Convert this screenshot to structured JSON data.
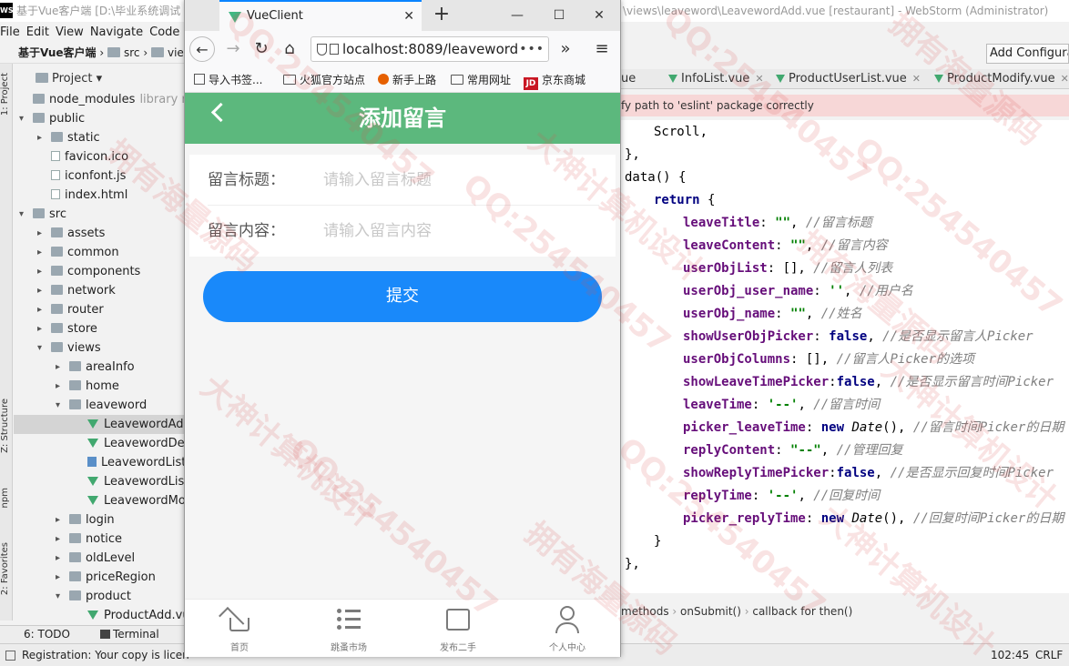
{
  "ide": {
    "title_left": "基于Vue客户端 [D:\\毕业系统调试",
    "title_right": "\\views\\leaveword\\LeavewordAdd.vue [restaurant] - WebStorm (Administrator)",
    "menu": [
      "File",
      "Edit",
      "View",
      "Navigate",
      "Code"
    ],
    "breadcrumb_project": "基于Vue客户端",
    "breadcrumb_src": "src",
    "breadcrumb_views": "vie",
    "project_label": "Project",
    "add_config": "Add Configurat",
    "side_tabs": {
      "project": "1: Project",
      "structure": "Z: Structure",
      "npm": "npm",
      "favorites": "2: Favorites"
    },
    "tree": [
      {
        "label": "node_modules",
        "extra": "library root",
        "type": "dir",
        "indent": 0,
        "arrow": ""
      },
      {
        "label": "public",
        "extra": "",
        "type": "dir",
        "indent": 0,
        "arrow": "▾"
      },
      {
        "label": "static",
        "extra": "",
        "type": "dir",
        "indent": 1,
        "arrow": "▸"
      },
      {
        "label": "favicon.ico",
        "extra": "",
        "type": "file",
        "indent": 1,
        "arrow": ""
      },
      {
        "label": "iconfont.js",
        "extra": "",
        "type": "file",
        "indent": 1,
        "arrow": ""
      },
      {
        "label": "index.html",
        "extra": "",
        "type": "file",
        "indent": 1,
        "arrow": ""
      },
      {
        "label": "src",
        "extra": "",
        "type": "dir",
        "indent": 0,
        "arrow": "▾"
      },
      {
        "label": "assets",
        "extra": "",
        "type": "dir",
        "indent": 1,
        "arrow": "▸"
      },
      {
        "label": "common",
        "extra": "",
        "type": "dir",
        "indent": 1,
        "arrow": "▸"
      },
      {
        "label": "components",
        "extra": "",
        "type": "dir",
        "indent": 1,
        "arrow": "▸"
      },
      {
        "label": "network",
        "extra": "",
        "type": "dir",
        "indent": 1,
        "arrow": "▸"
      },
      {
        "label": "router",
        "extra": "",
        "type": "dir",
        "indent": 1,
        "arrow": "▸"
      },
      {
        "label": "store",
        "extra": "",
        "type": "dir",
        "indent": 1,
        "arrow": "▸"
      },
      {
        "label": "views",
        "extra": "",
        "type": "dir",
        "indent": 1,
        "arrow": "▾"
      },
      {
        "label": "areaInfo",
        "extra": "",
        "type": "dir",
        "indent": 2,
        "arrow": "▸"
      },
      {
        "label": "home",
        "extra": "",
        "type": "dir",
        "indent": 2,
        "arrow": "▸"
      },
      {
        "label": "leaveword",
        "extra": "",
        "type": "dir",
        "indent": 2,
        "arrow": "▾"
      },
      {
        "label": "LeavewordAdd.vue",
        "extra": "",
        "type": "vue",
        "indent": 3,
        "arrow": "",
        "selected": true
      },
      {
        "label": "LeavewordDetail.vue",
        "extra": "",
        "type": "vue",
        "indent": 3,
        "arrow": ""
      },
      {
        "label": "LeavewordList.css",
        "extra": "",
        "type": "css",
        "indent": 3,
        "arrow": ""
      },
      {
        "label": "LeavewordList.vue",
        "extra": "",
        "type": "vue",
        "indent": 3,
        "arrow": ""
      },
      {
        "label": "LeavewordModify.vue",
        "extra": "",
        "type": "vue",
        "indent": 3,
        "arrow": ""
      },
      {
        "label": "login",
        "extra": "",
        "type": "dir",
        "indent": 2,
        "arrow": "▸"
      },
      {
        "label": "notice",
        "extra": "",
        "type": "dir",
        "indent": 2,
        "arrow": "▸"
      },
      {
        "label": "oldLevel",
        "extra": "",
        "type": "dir",
        "indent": 2,
        "arrow": "▸"
      },
      {
        "label": "priceRegion",
        "extra": "",
        "type": "dir",
        "indent": 2,
        "arrow": "▸"
      },
      {
        "label": "product",
        "extra": "",
        "type": "dir",
        "indent": 2,
        "arrow": "▾"
      },
      {
        "label": "ProductAdd.vue",
        "extra": "",
        "type": "vue",
        "indent": 3,
        "arrow": ""
      }
    ],
    "editor_tabs": [
      {
        "label": "ue",
        "closable": false
      },
      {
        "label": "InfoList.vue",
        "closable": true
      },
      {
        "label": "ProductUserList.vue",
        "closable": true
      },
      {
        "label": "ProductModify.vue",
        "closable": true
      }
    ],
    "warning": "fy path to 'eslint' package correctly",
    "code_lines": [
      {
        "indent": 1,
        "parts": [
          {
            "t": "Scroll,",
            "c": ""
          }
        ]
      },
      {
        "indent": 0,
        "parts": [
          {
            "t": "},",
            "c": ""
          }
        ]
      },
      {
        "indent": 0,
        "parts": [
          {
            "t": "data() {",
            "c": ""
          }
        ]
      },
      {
        "indent": 1,
        "parts": [
          {
            "t": "return",
            "c": "k"
          },
          {
            "t": " {",
            "c": ""
          }
        ]
      },
      {
        "indent": 2,
        "parts": [
          {
            "t": "leaveTitle",
            "c": "p"
          },
          {
            "t": ": ",
            "c": ""
          },
          {
            "t": "\"\"",
            "c": "s"
          },
          {
            "t": ", ",
            "c": ""
          },
          {
            "t": "//留言标题",
            "c": "c"
          }
        ]
      },
      {
        "indent": 2,
        "parts": [
          {
            "t": "leaveContent",
            "c": "p"
          },
          {
            "t": ": ",
            "c": ""
          },
          {
            "t": "\"\"",
            "c": "s"
          },
          {
            "t": ", ",
            "c": ""
          },
          {
            "t": "//留言内容",
            "c": "c"
          }
        ]
      },
      {
        "indent": 2,
        "parts": [
          {
            "t": "userObjList",
            "c": "p"
          },
          {
            "t": ": [], ",
            "c": ""
          },
          {
            "t": "//留言人列表",
            "c": "c"
          }
        ]
      },
      {
        "indent": 2,
        "parts": [
          {
            "t": "userObj_user_name",
            "c": "p"
          },
          {
            "t": ": ",
            "c": ""
          },
          {
            "t": "''",
            "c": "s"
          },
          {
            "t": ", ",
            "c": ""
          },
          {
            "t": "//用户名",
            "c": "c"
          }
        ]
      },
      {
        "indent": 2,
        "parts": [
          {
            "t": "userObj_name",
            "c": "p"
          },
          {
            "t": ": ",
            "c": ""
          },
          {
            "t": "\"\"",
            "c": "s"
          },
          {
            "t": ", ",
            "c": ""
          },
          {
            "t": "//姓名",
            "c": "c"
          }
        ]
      },
      {
        "indent": 2,
        "parts": [
          {
            "t": "showUserObjPicker",
            "c": "p"
          },
          {
            "t": ": ",
            "c": ""
          },
          {
            "t": "false",
            "c": "k"
          },
          {
            "t": ", ",
            "c": ""
          },
          {
            "t": "//是否显示留言人Picker",
            "c": "c"
          }
        ]
      },
      {
        "indent": 2,
        "parts": [
          {
            "t": "userObjColumns",
            "c": "p"
          },
          {
            "t": ": [], ",
            "c": ""
          },
          {
            "t": "//留言人Picker的选项",
            "c": "c"
          }
        ]
      },
      {
        "indent": 2,
        "parts": [
          {
            "t": "showLeaveTimePicker",
            "c": "p"
          },
          {
            "t": ":",
            "c": ""
          },
          {
            "t": "false",
            "c": "k"
          },
          {
            "t": ", ",
            "c": ""
          },
          {
            "t": "//是否显示留言时间Picker",
            "c": "c"
          }
        ]
      },
      {
        "indent": 2,
        "parts": [
          {
            "t": "leaveTime",
            "c": "p"
          },
          {
            "t": ": ",
            "c": ""
          },
          {
            "t": "'--'",
            "c": "s"
          },
          {
            "t": ", ",
            "c": ""
          },
          {
            "t": "//留言时间",
            "c": "c"
          }
        ]
      },
      {
        "indent": 2,
        "parts": [
          {
            "t": "picker_leaveTime",
            "c": "p"
          },
          {
            "t": ": ",
            "c": ""
          },
          {
            "t": "new",
            "c": "k"
          },
          {
            "t": " ",
            "c": ""
          },
          {
            "t": "Date",
            "c": "t"
          },
          {
            "t": "(), ",
            "c": ""
          },
          {
            "t": "//留言时间Picker的日期",
            "c": "c"
          }
        ]
      },
      {
        "indent": 2,
        "parts": [
          {
            "t": "replyContent",
            "c": "p"
          },
          {
            "t": ": ",
            "c": ""
          },
          {
            "t": "\"--\"",
            "c": "s"
          },
          {
            "t": ", ",
            "c": ""
          },
          {
            "t": "//管理回复",
            "c": "c"
          }
        ]
      },
      {
        "indent": 2,
        "parts": [
          {
            "t": "showReplyTimePicker",
            "c": "p"
          },
          {
            "t": ":",
            "c": ""
          },
          {
            "t": "false",
            "c": "k"
          },
          {
            "t": ", ",
            "c": ""
          },
          {
            "t": "//是否显示回复时间Picker",
            "c": "c"
          }
        ]
      },
      {
        "indent": 2,
        "parts": [
          {
            "t": "replyTime",
            "c": "p"
          },
          {
            "t": ": ",
            "c": ""
          },
          {
            "t": "'--'",
            "c": "s"
          },
          {
            "t": ", ",
            "c": ""
          },
          {
            "t": "//回复时间",
            "c": "c"
          }
        ]
      },
      {
        "indent": 2,
        "parts": [
          {
            "t": "picker_replyTime",
            "c": "p"
          },
          {
            "t": ": ",
            "c": ""
          },
          {
            "t": "new",
            "c": "k"
          },
          {
            "t": " ",
            "c": ""
          },
          {
            "t": "Date",
            "c": "t"
          },
          {
            "t": "(), ",
            "c": ""
          },
          {
            "t": "//回复时间Picker的日期",
            "c": "c"
          }
        ]
      },
      {
        "indent": 1,
        "parts": [
          {
            "t": "}",
            "c": ""
          }
        ]
      },
      {
        "indent": 0,
        "parts": [
          {
            "t": "},",
            "c": ""
          }
        ]
      }
    ],
    "code_breadcrumb": [
      "methods",
      "onSubmit()",
      "callback for then()"
    ],
    "bottom_tabs": [
      "6: TODO",
      "Terminal"
    ],
    "status_left": "Registration: Your copy is licen",
    "status_pos": "102:45",
    "status_crlf": "CRLF"
  },
  "browser": {
    "tab_title": "VueClient",
    "url": "localhost:8089/leaveword",
    "bookmarks": [
      {
        "label": "导入书签...",
        "icon": "imp"
      },
      {
        "label": "火狐官方站点",
        "icon": "folder"
      },
      {
        "label": "新手上路",
        "icon": "fox"
      },
      {
        "label": "常用网址",
        "icon": "folder"
      },
      {
        "label": "京东商城",
        "icon": "jd"
      }
    ],
    "jd_badge": "JD"
  },
  "app": {
    "header_title": "添加留言",
    "fields": [
      {
        "label": "留言标题：",
        "placeholder": "请输入留言标题"
      },
      {
        "label": "留言内容：",
        "placeholder": "请输入留言内容"
      }
    ],
    "submit_label": "提交",
    "tabbar": [
      {
        "label": "首页",
        "icon": "home-icon"
      },
      {
        "label": "跳蚤市场",
        "icon": "list-icon"
      },
      {
        "label": "发布二手",
        "icon": "bag-icon"
      },
      {
        "label": "个人中心",
        "icon": "user-icon"
      }
    ]
  },
  "watermark": {
    "lines": [
      "QQ:254540457",
      "大神计算机设计",
      "拥有海量源码"
    ]
  }
}
